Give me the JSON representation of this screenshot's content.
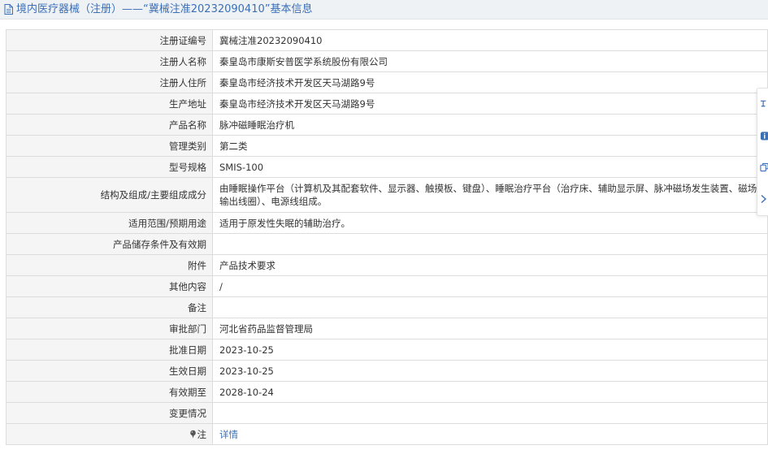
{
  "title": {
    "prefix": "境内医疗器械（注册）——",
    "reg_no_quoted": "“冀械注准20232090410”",
    "suffix": "基本信息"
  },
  "rows": [
    {
      "label": "注册证编号",
      "value": "冀械注准20232090410"
    },
    {
      "label": "注册人名称",
      "value": "秦皇岛市康斯安普医学系统股份有限公司"
    },
    {
      "label": "注册人住所",
      "value": "秦皇岛市经济技术开发区天马湖路9号"
    },
    {
      "label": "生产地址",
      "value": "秦皇岛市经济技术开发区天马湖路9号"
    },
    {
      "label": "产品名称",
      "value": "脉冲磁睡眠治疗机"
    },
    {
      "label": "管理类别",
      "value": "第二类"
    },
    {
      "label": "型号规格",
      "value": "SMIS-100"
    },
    {
      "label": "结构及组成/主要组成成分",
      "value": "由睡眠操作平台（计算机及其配套软件、显示器、触摸板、键盘）、睡眠治疗平台（治疗床、辅助显示屏、脉冲磁场发生装置、磁场输出线圈）、电源线组成。"
    },
    {
      "label": "适用范围/预期用途",
      "value": "适用于原发性失眠的辅助治疗。"
    },
    {
      "label": "产品储存条件及有效期",
      "value": ""
    },
    {
      "label": "附件",
      "value": "产品技术要求"
    },
    {
      "label": "其他内容",
      "value": "/"
    },
    {
      "label": "备注",
      "value": ""
    },
    {
      "label": "审批部门",
      "value": "河北省药品监督管理局"
    },
    {
      "label": "批准日期",
      "value": "2023-10-25"
    },
    {
      "label": "生效日期",
      "value": "2023-10-25"
    },
    {
      "label": "有效期至",
      "value": "2028-10-24"
    },
    {
      "label": "变更情况",
      "value": ""
    }
  ],
  "note_row": {
    "label": "注",
    "link": "详情"
  },
  "colors": {
    "title_blue": "#3b6fb6",
    "label_bg": "#f5f5f5",
    "border": "#dcdcdc",
    "title_bar_bg": "#eff2f5"
  },
  "icons": {
    "title": "document-icon",
    "note": "pin-icon",
    "toolbar": [
      "translate-icon",
      "info-icon",
      "copy-icon",
      "collapse-arrow-icon"
    ]
  }
}
